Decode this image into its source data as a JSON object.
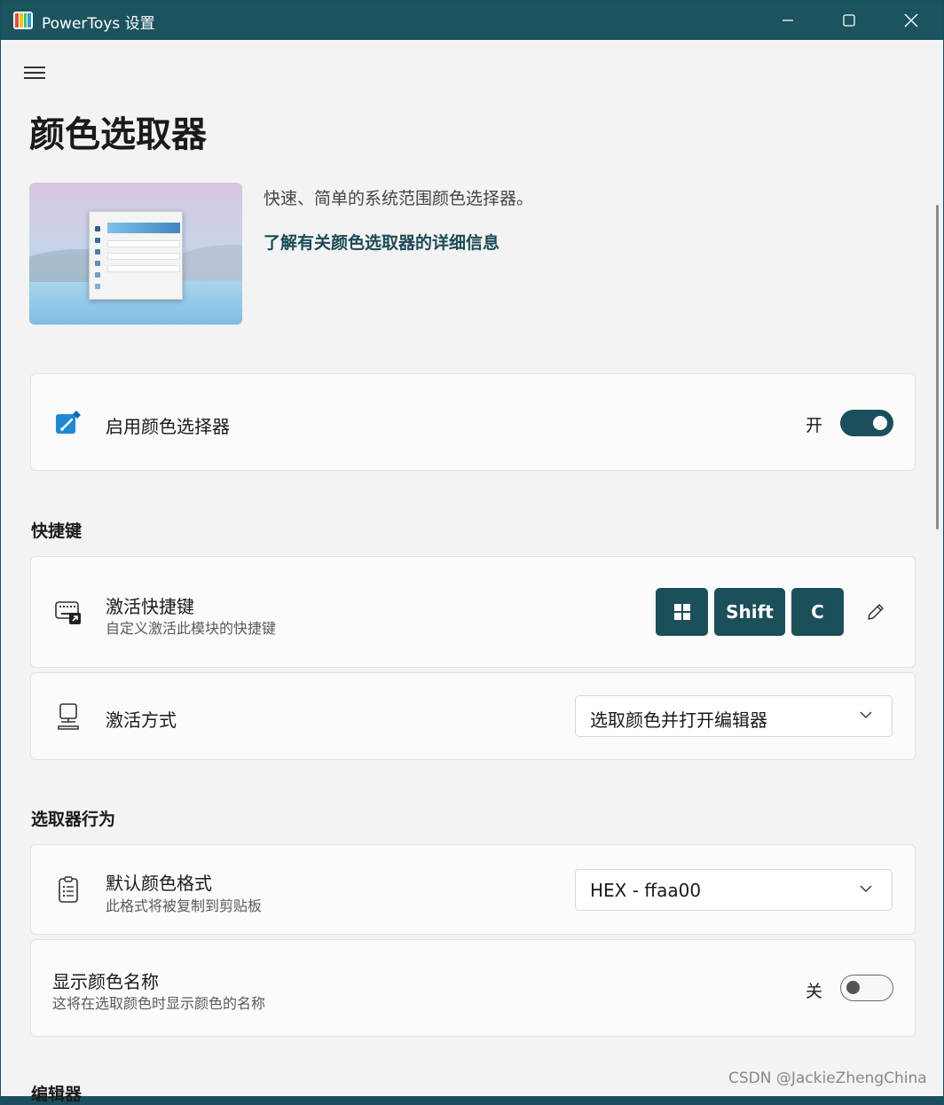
{
  "window": {
    "title": "PowerToys 设置",
    "icon": "powertoys-app-icon",
    "buttons": [
      "minimize-icon",
      "maximize-icon",
      "close-icon"
    ]
  },
  "nav": {
    "menu_icon": "hamburger-icon"
  },
  "page": {
    "title": "颜色选取器",
    "description": "快速、简单的系统范围颜色选择器。",
    "learn_more": "了解有关颜色选取器的详细信息"
  },
  "enable_card": {
    "label": "启用颜色选择器",
    "state_text": "开",
    "enabled": true,
    "icon": "color-picker-icon"
  },
  "shortcuts_section": {
    "title": "快捷键",
    "activation_shortcut": {
      "label": "激活快捷键",
      "description": "自定义激活此模块的快捷键",
      "keys": [
        "Win",
        "Shift",
        "C"
      ],
      "icon": "keyboard-shortcut-icon",
      "edit_icon": "pencil-icon"
    },
    "activation_behavior": {
      "label": "激活方式",
      "selected": "选取颜色并打开编辑器",
      "icon": "monitor-icon"
    }
  },
  "picker_section": {
    "title": "选取器行为",
    "default_format": {
      "label": "默认颜色格式",
      "description": "此格式将被复制到剪贴板",
      "selected": "HEX - ffaa00",
      "icon": "clipboard-list-icon"
    },
    "show_color_name": {
      "label": "显示颜色名称",
      "description": "这将在选取颜色时显示颜色的名称",
      "state_text": "关",
      "enabled": false
    }
  },
  "editor_section": {
    "title": "编辑器"
  },
  "watermark": "CSDN @JackieZhengChina",
  "colors": {
    "titlebar": "#1b535f",
    "accent": "#1b4f5a",
    "background": "#f3f3f3",
    "card": "#fbfbfb"
  }
}
